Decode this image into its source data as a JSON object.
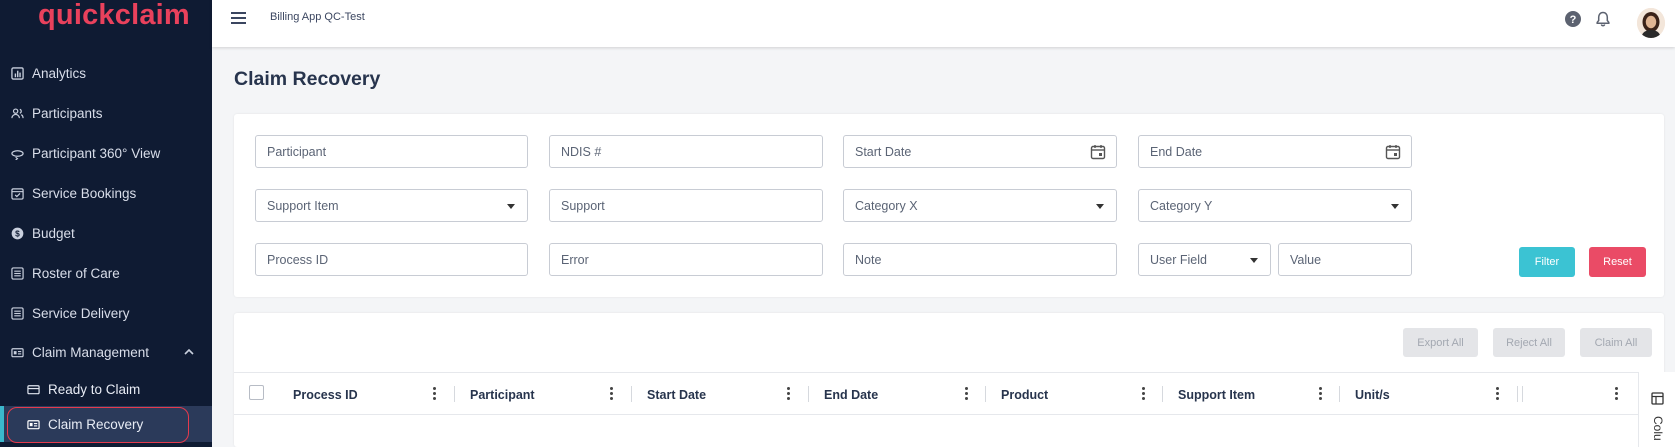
{
  "brand": {
    "logo_text": "quickclaim",
    "accent": "#e9415c"
  },
  "sidebar": {
    "items": [
      {
        "label": "Analytics",
        "icon": "analytics-icon"
      },
      {
        "label": "Participants",
        "icon": "participants-icon"
      },
      {
        "label": "Participant 360° View",
        "icon": "view-360-icon"
      },
      {
        "label": "Service Bookings",
        "icon": "calendar-check-icon"
      },
      {
        "label": "Budget",
        "icon": "dollar-icon"
      },
      {
        "label": "Roster of Care",
        "icon": "list-icon"
      },
      {
        "label": "Service Delivery",
        "icon": "list-icon"
      },
      {
        "label": "Claim Management",
        "icon": "claim-icon",
        "expanded": true
      }
    ],
    "subitems": [
      {
        "label": "Ready to Claim",
        "icon": "card-icon"
      },
      {
        "label": "Claim Recovery",
        "icon": "id-card-icon",
        "active": true
      }
    ]
  },
  "topbar": {
    "app_title": "Billing App QC-Test",
    "icons": [
      "menu-icon",
      "help-icon",
      "bell-icon",
      "avatar"
    ]
  },
  "page": {
    "title": "Claim Recovery"
  },
  "filters": {
    "participant": "Participant",
    "ndis": "NDIS #",
    "start_date": "Start Date",
    "end_date": "End Date",
    "support_item": "Support Item",
    "support": "Support",
    "category_x": "Category X",
    "category_y": "Category Y",
    "process_id": "Process ID",
    "error": "Error",
    "note": "Note",
    "user_field": "User Field",
    "value": "Value",
    "filter_label": "Filter",
    "reset_label": "Reset"
  },
  "table": {
    "actions": {
      "export_all": "Export All",
      "reject_all": "Reject All",
      "claim_all": "Claim All"
    },
    "columns": [
      "Process ID",
      "Participant",
      "Start Date",
      "End Date",
      "Product",
      "Support Item",
      "Unit/s"
    ],
    "columns_panel": "Colu"
  },
  "colors": {
    "sidebar_bg": "#0f1b33",
    "filter_btn": "#3bc3d3",
    "reset_btn": "#ea4b66",
    "active_bar": "#3bb7cc"
  }
}
